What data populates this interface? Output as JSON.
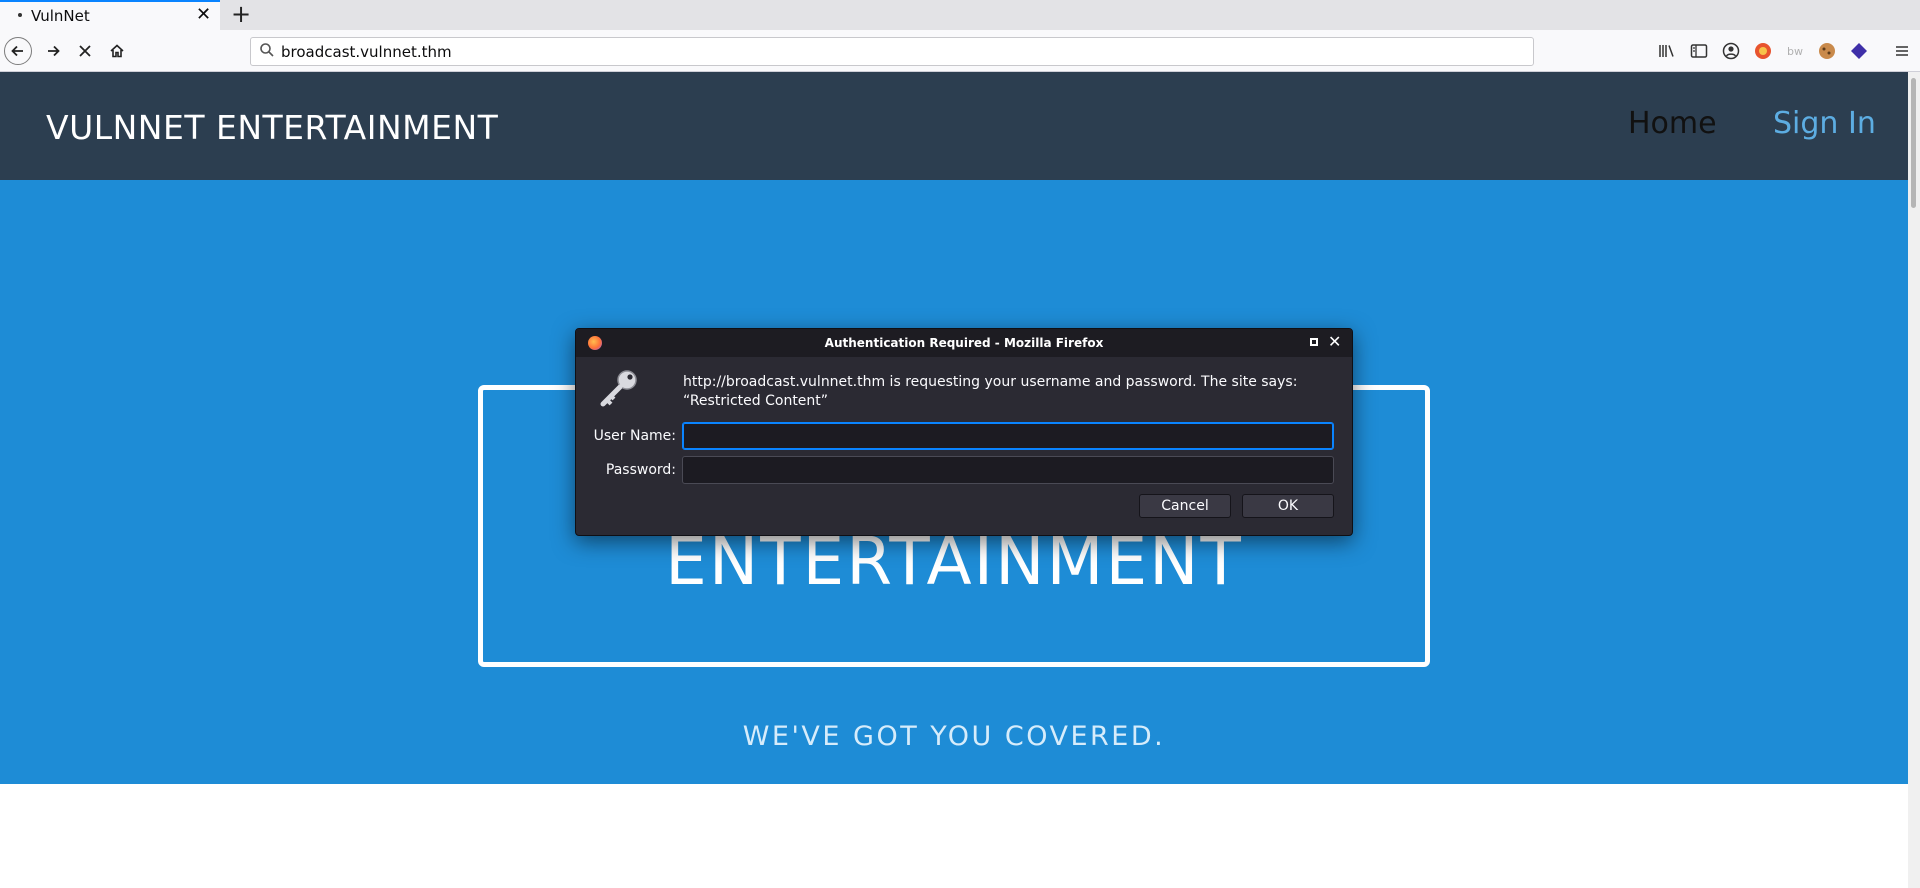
{
  "browser": {
    "tab_title": "VulnNet",
    "url": "broadcast.vulnnet.thm",
    "accent_color": "#0a84ff"
  },
  "site": {
    "brand": "VULNNET ENTERTAINMENT",
    "nav": {
      "home": "Home",
      "sign_in": "Sign In"
    },
    "hero_title": "ENTERTAINMENT",
    "hero_subtitle": "WE'VE GOT YOU COVERED.",
    "colors": {
      "header": "#2c3e50",
      "hero": "#1e8cd6",
      "sign_in": "#5dade2"
    }
  },
  "dialog": {
    "title": "Authentication Required - Mozilla Firefox",
    "message": "http://broadcast.vulnnet.thm is requesting your username and password. The site says: “Restricted Content”",
    "username_label": "User Name:",
    "username_value": "",
    "password_label": "Password:",
    "password_value": "",
    "cancel_label": "Cancel",
    "ok_label": "OK"
  }
}
